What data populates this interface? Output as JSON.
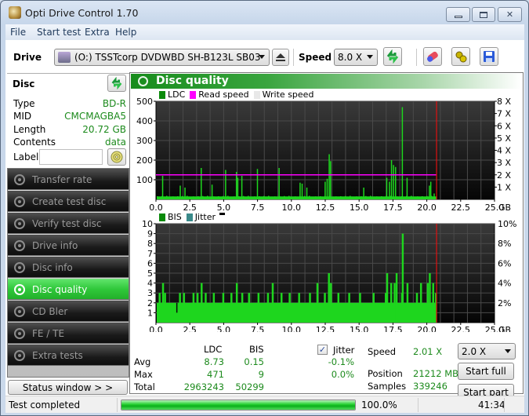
{
  "window": {
    "title": "Opti Drive Control 1.70",
    "controls": {
      "minimize": "minimize",
      "maximize": "maximize",
      "close": "close"
    }
  },
  "menu": [
    "File",
    "Start test",
    "Extra",
    "Help"
  ],
  "toolbar": {
    "drive_label": "Drive",
    "drive_value": "(O:)  TSSTcorp DVDWBD SH-B123L SB03",
    "speed_label": "Speed",
    "speed_value": "8.0 X",
    "icons": [
      "eject-icon",
      "refresh-icon",
      "erase-icon",
      "settings-icon",
      "save-icon"
    ]
  },
  "disc": {
    "title": "Disc",
    "fields": [
      {
        "label": "Type",
        "value": "BD-R"
      },
      {
        "label": "MID",
        "value": "CMCMAGBA5"
      },
      {
        "label": "Length",
        "value": "20.72 GB"
      },
      {
        "label": "Contents",
        "value": "data"
      }
    ],
    "label_field": {
      "label": "Label",
      "value": ""
    }
  },
  "nav": {
    "items": [
      {
        "label": "Transfer rate",
        "active": false
      },
      {
        "label": "Create test disc",
        "active": false
      },
      {
        "label": "Verify test disc",
        "active": false
      },
      {
        "label": "Drive info",
        "active": false
      },
      {
        "label": "Disc info",
        "active": false
      },
      {
        "label": "Disc quality",
        "active": true
      },
      {
        "label": "CD Bler",
        "active": false
      },
      {
        "label": "FE / TE",
        "active": false
      },
      {
        "label": "Extra tests",
        "active": false
      }
    ],
    "status_window_button": "Status window > >"
  },
  "panel": {
    "title": "Disc quality",
    "legend_top": [
      {
        "label": "LDC",
        "color": "#0a8a0a"
      },
      {
        "label": "Read speed",
        "color": "#ff00ff"
      },
      {
        "label": "Write speed",
        "color": "#e8e8e8"
      }
    ],
    "legend_bottom": [
      {
        "label": "BIS",
        "color": "#0a8a0a"
      },
      {
        "label": "Jitter",
        "color": "#3a8a8a"
      }
    ]
  },
  "chart_data": [
    {
      "type": "bar",
      "title": "LDC",
      "x_unit": "GB",
      "xlim": [
        0,
        25
      ],
      "x_ticks": [
        "0.0",
        "2.5",
        "5.0",
        "7.5",
        "10.0",
        "12.5",
        "15.0",
        "17.5",
        "20.0",
        "22.5",
        "25.0"
      ],
      "ylim": [
        0,
        500
      ],
      "y_ticks": [
        "100",
        "200",
        "300",
        "400",
        "500"
      ],
      "y2lim": [
        0,
        8
      ],
      "y2_ticks": [
        "1 X",
        "2 X",
        "3 X",
        "4 X",
        "5 X",
        "6 X",
        "7 X",
        "8 X"
      ],
      "grid": true,
      "disc_end_gb": 20.72,
      "series": [
        {
          "name": "LDC",
          "color": "#1ed61e",
          "baseline": 15,
          "spikes": [
            {
              "x": 0.45,
              "y": 120
            },
            {
              "x": 1.75,
              "y": 70
            },
            {
              "x": 2.1,
              "y": 60
            },
            {
              "x": 3.3,
              "y": 160
            },
            {
              "x": 4.1,
              "y": 75
            },
            {
              "x": 5.1,
              "y": 150
            },
            {
              "x": 5.9,
              "y": 140
            },
            {
              "x": 6.0,
              "y": 110
            },
            {
              "x": 6.3,
              "y": 120
            },
            {
              "x": 7.45,
              "y": 155
            },
            {
              "x": 9.05,
              "y": 160
            },
            {
              "x": 10.6,
              "y": 85
            },
            {
              "x": 10.75,
              "y": 80
            },
            {
              "x": 11.1,
              "y": 60
            },
            {
              "x": 12.45,
              "y": 90
            },
            {
              "x": 12.6,
              "y": 105
            },
            {
              "x": 12.75,
              "y": 230
            },
            {
              "x": 12.85,
              "y": 195
            },
            {
              "x": 15.3,
              "y": 60
            },
            {
              "x": 17.0,
              "y": 110
            },
            {
              "x": 17.2,
              "y": 90
            },
            {
              "x": 17.35,
              "y": 200
            },
            {
              "x": 17.5,
              "y": 175
            },
            {
              "x": 17.65,
              "y": 165
            },
            {
              "x": 18.15,
              "y": 470
            },
            {
              "x": 18.5,
              "y": 110
            },
            {
              "x": 20.15,
              "y": 70
            },
            {
              "x": 20.25,
              "y": 90
            },
            {
              "x": 20.5,
              "y": 30
            }
          ]
        },
        {
          "name": "Read speed",
          "color": "#ff00ff",
          "value_x": 2.0,
          "range_gb": [
            0,
            20.72
          ]
        }
      ]
    },
    {
      "type": "bar",
      "title": "BIS",
      "x_unit": "GB",
      "xlim": [
        0,
        25
      ],
      "x_ticks": [
        "0.0",
        "2.5",
        "5.0",
        "7.5",
        "10.0",
        "12.5",
        "15.0",
        "17.5",
        "20.0",
        "22.5",
        "25.0"
      ],
      "ylim": [
        0,
        10
      ],
      "y_ticks": [
        "1",
        "2",
        "3",
        "4",
        "5",
        "6",
        "7",
        "8",
        "9",
        "10"
      ],
      "y2lim": [
        0,
        10
      ],
      "y2_ticks": [
        "2%",
        "4%",
        "6%",
        "8%",
        "10%"
      ],
      "grid": true,
      "disc_end_gb": 20.72,
      "series": [
        {
          "name": "BIS",
          "color": "#1ed61e",
          "baseline": 2,
          "spikes": [
            {
              "x": 0.2,
              "y": 3
            },
            {
              "x": 0.45,
              "y": 4
            },
            {
              "x": 0.6,
              "y": 3
            },
            {
              "x": 1.5,
              "y": 1
            },
            {
              "x": 1.7,
              "y": 3
            },
            {
              "x": 2.0,
              "y": 3
            },
            {
              "x": 2.7,
              "y": 3
            },
            {
              "x": 3.0,
              "y": 3
            },
            {
              "x": 3.3,
              "y": 4
            },
            {
              "x": 3.6,
              "y": 3
            },
            {
              "x": 4.2,
              "y": 3
            },
            {
              "x": 4.9,
              "y": 3
            },
            {
              "x": 5.5,
              "y": 3
            },
            {
              "x": 5.9,
              "y": 4
            },
            {
              "x": 6.3,
              "y": 3
            },
            {
              "x": 6.8,
              "y": 3
            },
            {
              "x": 7.5,
              "y": 3
            },
            {
              "x": 8.2,
              "y": 3
            },
            {
              "x": 8.55,
              "y": 4
            },
            {
              "x": 9.2,
              "y": 3
            },
            {
              "x": 9.8,
              "y": 3
            },
            {
              "x": 10.5,
              "y": 3
            },
            {
              "x": 11.3,
              "y": 3
            },
            {
              "x": 11.85,
              "y": 4
            },
            {
              "x": 12.4,
              "y": 3
            },
            {
              "x": 12.7,
              "y": 5
            },
            {
              "x": 12.85,
              "y": 4
            },
            {
              "x": 13.4,
              "y": 3
            },
            {
              "x": 14.2,
              "y": 3
            },
            {
              "x": 15.0,
              "y": 3
            },
            {
              "x": 16.0,
              "y": 3
            },
            {
              "x": 16.9,
              "y": 3
            },
            {
              "x": 17.0,
              "y": 5
            },
            {
              "x": 17.3,
              "y": 4
            },
            {
              "x": 17.55,
              "y": 4
            },
            {
              "x": 17.7,
              "y": 5
            },
            {
              "x": 18.1,
              "y": 3
            },
            {
              "x": 18.15,
              "y": 9
            },
            {
              "x": 18.5,
              "y": 4
            },
            {
              "x": 19.2,
              "y": 3
            },
            {
              "x": 19.5,
              "y": 4
            },
            {
              "x": 20.0,
              "y": 4
            },
            {
              "x": 20.15,
              "y": 5
            },
            {
              "x": 20.4,
              "y": 4
            },
            {
              "x": 20.6,
              "y": 3
            }
          ]
        },
        {
          "name": "Jitter",
          "color": "#3a8a8a",
          "values": []
        }
      ]
    }
  ],
  "stats": {
    "headers": {
      "ldc": "LDC",
      "bis": "BIS",
      "jitter": "Jitter"
    },
    "jitter_checked": true,
    "rows": [
      {
        "label": "Avg",
        "ldc": "8.73",
        "bis": "0.15",
        "jitter": "-0.1%"
      },
      {
        "label": "Max",
        "ldc": "471",
        "bis": "9",
        "jitter": "0.0%"
      },
      {
        "label": "Total",
        "ldc": "2963243",
        "bis": "50299",
        "jitter": ""
      }
    ],
    "speed_label": "Speed",
    "speed_value": "2.01 X",
    "position_label": "Position",
    "position_value": "21212 MB",
    "samples_label": "Samples",
    "samples_value": "339246",
    "speed_select": "2.0 X",
    "start_full": "Start full",
    "start_part": "Start part"
  },
  "statusbar": {
    "message": "Test completed",
    "progress_percent": 100.0,
    "progress_text": "100.0%",
    "time": "41:34"
  }
}
